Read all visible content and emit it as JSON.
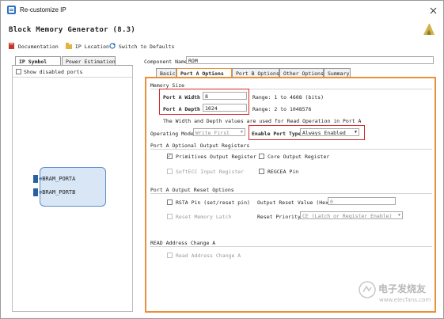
{
  "window": {
    "title": "Re-customize IP"
  },
  "header": {
    "title": "Block Memory Generator (8.3)"
  },
  "toolbar": {
    "documentation": "Documentation",
    "ip_location": "IP Location",
    "switch_defaults": "Switch to Defaults"
  },
  "left_tabs": [
    "IP Symbol",
    "Power Estimation"
  ],
  "left": {
    "show_disabled": "Show disabled ports",
    "port_a": "BRAM_PORTA",
    "port_b": "BRAM_PORTB"
  },
  "component": {
    "label": "Component Name",
    "value": "ROM"
  },
  "right_tabs": [
    "Basic",
    "Port A Options",
    "Port B Options",
    "Other Options",
    "Summary"
  ],
  "memory_size": {
    "title": "Memory Size",
    "width_label": "Port A Width",
    "width_value": "8",
    "width_range": "Range: 1 to 4608 (bits)",
    "depth_label": "Port A Depth",
    "depth_value": "1024",
    "depth_range": "Range: 2 to 1048576",
    "note": "The Width and Depth values are used for Read Operation in Port A"
  },
  "operating_mode": {
    "label": "Operating Mode",
    "value": "Write First"
  },
  "enable_port": {
    "label": "Enable Port Type",
    "value": "Always Enabled"
  },
  "output_registers": {
    "title": "Port A Optional Output Registers",
    "primitives": "Primitives Output Register",
    "core": "Core Output Register",
    "softecc": "SoftECC Input Register",
    "regcea": "REGCEA Pin"
  },
  "reset": {
    "title": "Port A Output Reset Options",
    "rsta": "RSTA Pin (set/reset pin)",
    "reset_value_label": "Output Reset Value (Hex)",
    "reset_value": "0",
    "reset_latch": "Reset Memory Latch",
    "priority_label": "Reset Priority",
    "priority_value": "CE (Latch or Register Enable)"
  },
  "read_change": {
    "title": "READ Address Change A",
    "label": "Read Address Change A"
  },
  "watermark": {
    "line1": "电子发烧友",
    "line2": "www.elecfans.com"
  },
  "colors": {
    "highlight": "#d9262a",
    "accent": "#e8913a",
    "symbol_bg": "#d8e6f5"
  }
}
